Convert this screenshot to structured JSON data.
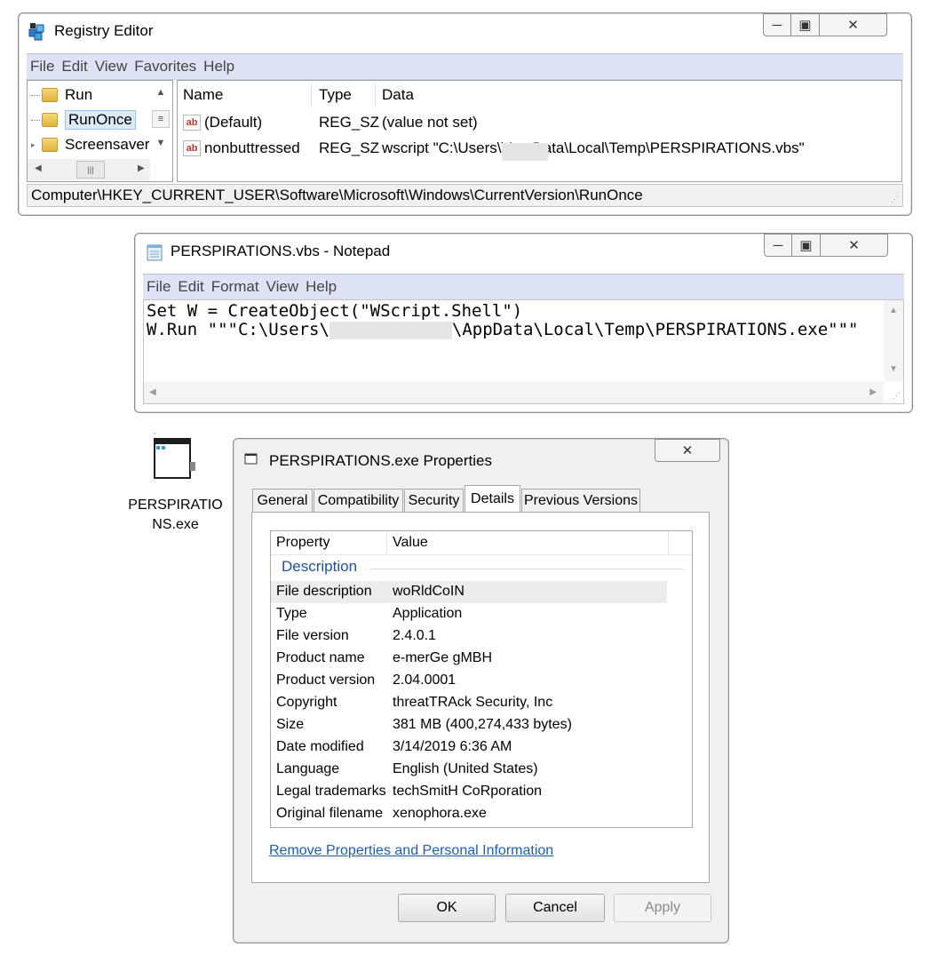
{
  "regedit": {
    "title": "Registry Editor",
    "menu": [
      "File",
      "Edit",
      "View",
      "Favorites",
      "Help"
    ],
    "tree": [
      "Run",
      "RunOnce",
      "Screensaver"
    ],
    "columns": {
      "name": "Name",
      "type": "Type",
      "data": "Data"
    },
    "rows": [
      {
        "name": "(Default)",
        "type": "REG_SZ",
        "data": "(value not set)"
      },
      {
        "name": "nonbuttressed",
        "type": "REG_SZ",
        "data_prefix": "wscript \"C:\\Users\\",
        "data_suffix": "\\AppData\\Local\\Temp\\PERSPIRATIONS.vbs\""
      }
    ],
    "status": "Computer\\HKEY_CURRENT_USER\\Software\\Microsoft\\Windows\\CurrentVersion\\RunOnce",
    "icon_ab": "ab"
  },
  "notepad": {
    "title": "PERSPIRATIONS.vbs - Notepad",
    "menu": [
      "File",
      "Edit",
      "Format",
      "View",
      "Help"
    ],
    "line1": "Set W = CreateObject(\"WScript.Shell\")",
    "line2_prefix": "W.Run \"\"\"C:\\Users\\",
    "line2_suffix": "\\AppData\\Local\\Temp\\PERSPIRATIONS.exe\"\"\""
  },
  "desktop_icon": {
    "label_line1": "PERSPIRATIO",
    "label_line2": "NS.exe"
  },
  "properties": {
    "title": "PERSPIRATIONS.exe Properties",
    "tabs": [
      "General",
      "Compatibility",
      "Security",
      "Details",
      "Previous Versions"
    ],
    "active_tab": "Details",
    "header": {
      "property": "Property",
      "value": "Value"
    },
    "section": "Description",
    "rows": [
      {
        "k": "File description",
        "v": "woRldCoIN"
      },
      {
        "k": "Type",
        "v": "Application"
      },
      {
        "k": "File version",
        "v": "2.4.0.1"
      },
      {
        "k": "Product name",
        "v": "e-merGe gMBH"
      },
      {
        "k": "Product version",
        "v": "2.04.0001"
      },
      {
        "k": "Copyright",
        "v": "threatTRAck Security, Inc"
      },
      {
        "k": "Size",
        "v": "381 MB (400,274,433 bytes)"
      },
      {
        "k": "Date modified",
        "v": "3/14/2019 6:36 AM"
      },
      {
        "k": "Language",
        "v": "English (United States)"
      },
      {
        "k": "Legal trademarks",
        "v": "techSmitH CoRporation"
      },
      {
        "k": "Original filename",
        "v": "xenophora.exe"
      }
    ],
    "link": "Remove Properties and Personal Information",
    "buttons": {
      "ok": "OK",
      "cancel": "Cancel",
      "apply": "Apply"
    }
  },
  "colors": {
    "link": "#1a5fb4",
    "section": "#1f4fa8",
    "menubar": "#dde3f4"
  }
}
